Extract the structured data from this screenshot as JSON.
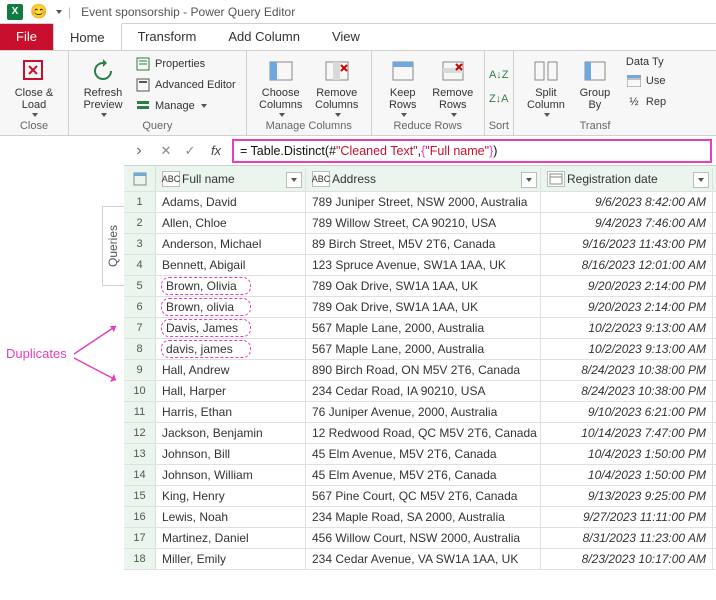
{
  "titlebar": {
    "excel_abbr": "X",
    "title": "Event sponsorship - Power Query Editor",
    "smiley": "😊"
  },
  "tabs": {
    "file": "File",
    "home": "Home",
    "transform": "Transform",
    "add_column": "Add Column",
    "view": "View"
  },
  "ribbon": {
    "close_load": "Close &\nLoad",
    "close_group": "Close",
    "refresh": "Refresh\nPreview",
    "properties": "Properties",
    "advanced_editor": "Advanced Editor",
    "manage": "Manage",
    "query_group": "Query",
    "choose_columns": "Choose\nColumns",
    "remove_columns": "Remove\nColumns",
    "manage_columns_group": "Manage Columns",
    "keep_rows": "Keep\nRows",
    "remove_rows": "Remove\nRows",
    "reduce_rows_group": "Reduce Rows",
    "sort_group": "Sort",
    "split_column": "Split\nColumn",
    "group_by": "Group\nBy",
    "data_ty": "Data Ty",
    "use": "Use",
    "replace": "Rep",
    "transf_group": "Transf"
  },
  "queries_label": "Queries",
  "formula": {
    "prefix": "= Table.Distinct(#",
    "ref": "\"Cleaned Text\"",
    "mid": ", ",
    "brace_open": "{",
    "col": "\"Full name\"",
    "brace_close": "}",
    "suffix": ")"
  },
  "columns": {
    "name": "Full name",
    "addr": "Address",
    "date": "Registration date"
  },
  "type_text": "ABC",
  "dup_label": "Duplicates",
  "rows": [
    {
      "n": "1",
      "name": "Adams, David",
      "addr": "789 Juniper Street, NSW 2000, Australia",
      "date": "9/6/2023 8:42:00 AM"
    },
    {
      "n": "2",
      "name": "Allen, Chloe",
      "addr": "789 Willow Street, CA 90210, USA",
      "date": "9/4/2023 7:46:00 AM"
    },
    {
      "n": "3",
      "name": "Anderson, Michael",
      "addr": "89 Birch Street, M5V 2T6, Canada",
      "date": "9/16/2023 11:43:00 PM"
    },
    {
      "n": "4",
      "name": "Bennett, Abigail",
      "addr": "123 Spruce Avenue, SW1A 1AA, UK",
      "date": "8/16/2023 12:01:00 AM"
    },
    {
      "n": "5",
      "name": "Brown, Olivia",
      "addr": "789 Oak Drive, SW1A 1AA, UK",
      "date": "9/20/2023 2:14:00 PM",
      "dup": "a"
    },
    {
      "n": "6",
      "name": "Brown, olivia",
      "addr": "789 Oak Drive, SW1A 1AA, UK",
      "date": "9/20/2023 2:14:00 PM",
      "dup": "a"
    },
    {
      "n": "7",
      "name": "Davis, James",
      "addr": "567 Maple Lane, 2000, Australia",
      "date": "10/2/2023 9:13:00 AM",
      "dup": "b"
    },
    {
      "n": "8",
      "name": "davis, james",
      "addr": "567 Maple Lane, 2000, Australia",
      "date": "10/2/2023 9:13:00 AM",
      "dup": "b"
    },
    {
      "n": "9",
      "name": "Hall, Andrew",
      "addr": "890 Birch Road, ON M5V 2T6, Canada",
      "date": "8/24/2023 10:38:00 PM"
    },
    {
      "n": "10",
      "name": "Hall, Harper",
      "addr": "234 Cedar Road, IA 90210, USA",
      "date": "8/24/2023 10:38:00 PM"
    },
    {
      "n": "11",
      "name": "Harris, Ethan",
      "addr": "76 Juniper Avenue, 2000, Australia",
      "date": "9/10/2023 6:21:00 PM"
    },
    {
      "n": "12",
      "name": "Jackson, Benjamin",
      "addr": "12 Redwood Road, QC M5V 2T6, Canada",
      "date": "10/14/2023 7:47:00 PM"
    },
    {
      "n": "13",
      "name": "Johnson, Bill",
      "addr": "45 Elm Avenue, M5V 2T6, Canada",
      "date": "10/4/2023 1:50:00 PM"
    },
    {
      "n": "14",
      "name": "Johnson, William",
      "addr": "45 Elm Avenue, M5V 2T6, Canada",
      "date": "10/4/2023 1:50:00 PM"
    },
    {
      "n": "15",
      "name": "King, Henry",
      "addr": "567 Pine Court, QC M5V 2T6, Canada",
      "date": "9/13/2023 9:25:00 PM"
    },
    {
      "n": "16",
      "name": "Lewis, Noah",
      "addr": "234 Maple Road, SA 2000, Australia",
      "date": "9/27/2023 11:11:00 PM"
    },
    {
      "n": "17",
      "name": "Martinez, Daniel",
      "addr": "456 Willow Court, NSW 2000, Australia",
      "date": "8/31/2023 11:23:00 AM"
    },
    {
      "n": "18",
      "name": "Miller, Emily",
      "addr": "234 Cedar Avenue, VA SW1A 1AA, UK",
      "date": "8/23/2023 10:17:00 AM"
    }
  ]
}
